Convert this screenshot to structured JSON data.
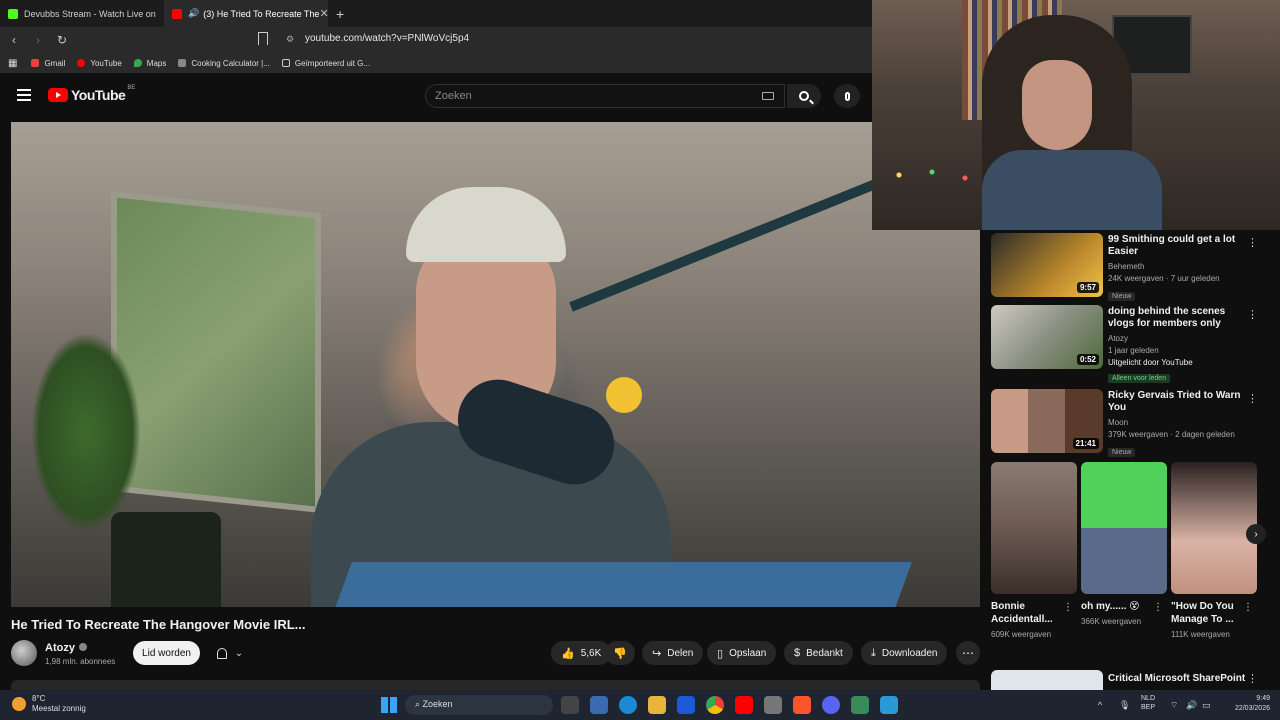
{
  "browser": {
    "tabs": [
      {
        "label": "Devubbs Stream - Watch Live on",
        "favicon_color": "#53fc18"
      },
      {
        "label": "(3) He Tried To Recreate The",
        "favicon_color": "#ff0000",
        "active": true
      }
    ],
    "new_tab": "+",
    "url": "youtube.com/watch?v=PNlWoVcj5p4",
    "bookmarks": [
      {
        "label": "Gmail",
        "icon_color": "#ea4335"
      },
      {
        "label": "YouTube",
        "icon_color": "#ff0000"
      },
      {
        "label": "Maps",
        "icon_color": "#34a853"
      },
      {
        "label": "Cooking Calculator |...",
        "icon_color": "#888888"
      },
      {
        "label": "Geïmporteerd uit G...",
        "icon_color": "#cccccc"
      }
    ]
  },
  "youtube": {
    "logo_text": "YouTube",
    "region": "BE",
    "search_placeholder": "Zoeken"
  },
  "video": {
    "title": "He Tried To Recreate The Hangover Movie IRL...",
    "channel": "Atozy",
    "subscribers": "1,98 mln. abonnees",
    "join_label": "Lid worden",
    "likes": "5,6K",
    "share_label": "Delen",
    "save_label": "Opslaan",
    "thanks_label": "Bedankt",
    "download_label": "Downloaden"
  },
  "sidebar": {
    "videos": [
      {
        "title": "99 Smithing could get a lot Easier",
        "channel": "Behemeth",
        "meta": "24K weergaven · 7 uur geleden",
        "badge": "Nieuw",
        "duration": "9:57",
        "thumb_color": "#6b4a12"
      },
      {
        "title": "doing behind the scenes vlogs for members only",
        "channel": "Atozy",
        "meta": "1 jaar geleden",
        "featured": "Uitgelicht door YouTube",
        "badge": "Alleen voor leden",
        "duration": "0:52",
        "thumb_color": "#8a8f82"
      },
      {
        "title": "Ricky Gervais Tried to Warn You",
        "channel": "Moon",
        "meta": "379K weergaven · 2 dagen geleden",
        "badge": "Nieuw",
        "duration": "21:41",
        "thumb_color": "#3a3328"
      }
    ],
    "shorts": [
      {
        "title": "Bonnie Accidentall...",
        "views": "609K weergaven",
        "thumb_color": "#6c5a52"
      },
      {
        "title": "oh my...... 😵",
        "views": "366K weergaven",
        "thumb_color": "#4fd15a"
      },
      {
        "title": "\"How Do You Manage To ...",
        "views": "111K weergaven",
        "thumb_color": "#d9b3a5"
      }
    ],
    "last_title": "Critical Microsoft SharePoint"
  },
  "taskbar": {
    "temp": "8°C",
    "weather": "Meestal zonnig",
    "search": "Zoeken",
    "lang1": "NLD",
    "lang2": "BEP",
    "time": "9:49",
    "date": "22/03/2026"
  }
}
